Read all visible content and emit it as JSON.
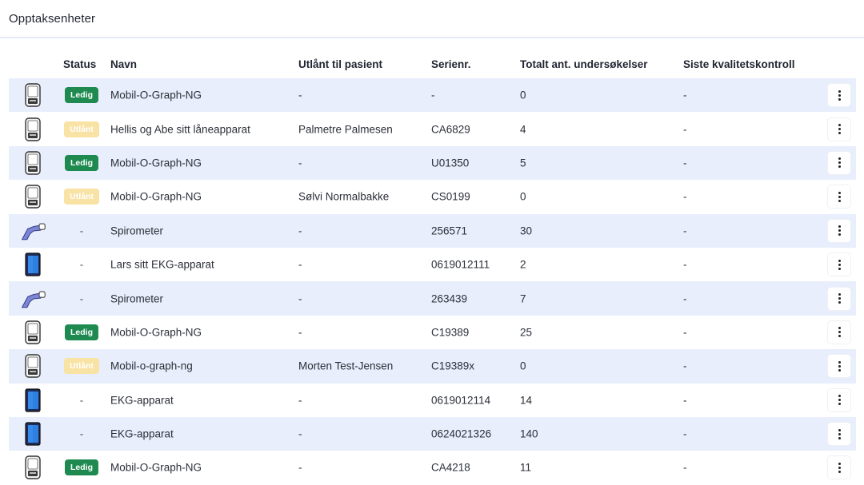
{
  "header": {
    "title": "Opptaksenheter"
  },
  "columns": {
    "status": "Status",
    "name": "Navn",
    "patient": "Utlånt til pasient",
    "serial": "Serienr.",
    "count": "Totalt ant. undersøkelser",
    "qc": "Siste kvalitetskontroll"
  },
  "rows": [
    {
      "icon": "bp-monitor-icon",
      "status": "Ledig",
      "name": "Mobil-O-Graph-NG",
      "patient": "-",
      "serial": "-",
      "count": "0",
      "qc": "-"
    },
    {
      "icon": "bp-monitor-icon",
      "status": "Utlånt",
      "name": "Hellis og Abe sitt låneapparat",
      "patient": "Palmetre Palmesen",
      "serial": "CA6829",
      "count": "4",
      "qc": "-"
    },
    {
      "icon": "bp-monitor-icon",
      "status": "Ledig",
      "name": "Mobil-O-Graph-NG",
      "patient": "-",
      "serial": "U01350",
      "count": "5",
      "qc": "-"
    },
    {
      "icon": "bp-monitor-icon",
      "status": "Utlånt",
      "name": "Mobil-O-Graph-NG",
      "patient": "Sølvi Normalbakke",
      "serial": "CS0199",
      "count": "0",
      "qc": "-"
    },
    {
      "icon": "spirometer-icon",
      "status": "-",
      "name": "Spirometer",
      "patient": "-",
      "serial": "256571",
      "count": "30",
      "qc": "-"
    },
    {
      "icon": "ekg-device-icon",
      "status": "-",
      "name": "Lars sitt EKG-apparat",
      "patient": "-",
      "serial": "0619012111",
      "count": "2",
      "qc": "-"
    },
    {
      "icon": "spirometer-icon",
      "status": "-",
      "name": "Spirometer",
      "patient": "-",
      "serial": "263439",
      "count": "7",
      "qc": "-"
    },
    {
      "icon": "bp-monitor-icon",
      "status": "Ledig",
      "name": "Mobil-O-Graph-NG",
      "patient": "-",
      "serial": "C19389",
      "count": "25",
      "qc": "-"
    },
    {
      "icon": "bp-monitor-icon",
      "status": "Utlånt",
      "name": "Mobil-o-graph-ng",
      "patient": "Morten Test-Jensen",
      "serial": "C19389x",
      "count": "0",
      "qc": "-"
    },
    {
      "icon": "ekg-device-icon",
      "status": "-",
      "name": "EKG-apparat",
      "patient": "-",
      "serial": "0619012114",
      "count": "14",
      "qc": "-"
    },
    {
      "icon": "ekg-device-icon",
      "status": "-",
      "name": "EKG-apparat",
      "patient": "-",
      "serial": "0624021326",
      "count": "140",
      "qc": "-"
    },
    {
      "icon": "bp-monitor-icon",
      "status": "Ledig",
      "name": "Mobil-O-Graph-NG",
      "patient": "-",
      "serial": "CA4218",
      "count": "11",
      "qc": "-"
    }
  ],
  "colors": {
    "row_alt": "#e8eefb",
    "badge_ledig": "#1e8a50",
    "badge_utlant": "#f8e2a4"
  }
}
